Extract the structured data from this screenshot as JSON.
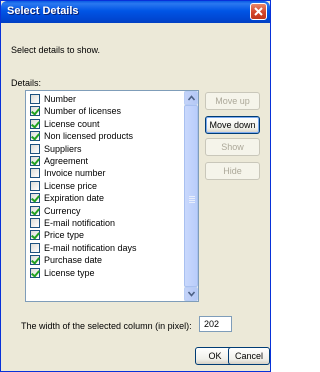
{
  "window": {
    "title": "Select Details"
  },
  "subtitle": "Select details to show.",
  "details_label": "Details:",
  "items": [
    {
      "label": "Number",
      "checked": false
    },
    {
      "label": "Number of licenses",
      "checked": true
    },
    {
      "label": "License count",
      "checked": true
    },
    {
      "label": "Non licensed products",
      "checked": true
    },
    {
      "label": "Suppliers",
      "checked": false
    },
    {
      "label": "Agreement",
      "checked": true
    },
    {
      "label": "Invoice number",
      "checked": false
    },
    {
      "label": "License price",
      "checked": false
    },
    {
      "label": "Expiration date",
      "checked": true
    },
    {
      "label": "Currency",
      "checked": true
    },
    {
      "label": "E-mail notification",
      "checked": false
    },
    {
      "label": "Price type",
      "checked": true
    },
    {
      "label": "E-mail notification days",
      "checked": false
    },
    {
      "label": "Purchase date",
      "checked": true
    },
    {
      "label": "License type",
      "checked": true
    }
  ],
  "buttons": {
    "move_up": "Move up",
    "move_down": "Move down",
    "show": "Show",
    "hide": "Hide",
    "ok": "OK",
    "cancel": "Cancel"
  },
  "column_width": {
    "label": "The width of the selected column (in pixel):",
    "value": "202"
  },
  "colors": {
    "titlebar": "#0055e5",
    "close": "#d4452a",
    "dialog_bg": "#ece9d8",
    "check": "#21a121"
  }
}
